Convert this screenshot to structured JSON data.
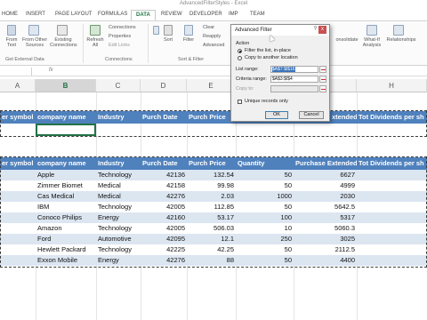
{
  "window": {
    "title": "AdvancedFilterStyles - Excel"
  },
  "tabs": [
    {
      "label": "HOME"
    },
    {
      "label": "INSERT"
    },
    {
      "label": "PAGE LAYOUT"
    },
    {
      "label": "FORMULAS"
    },
    {
      "label": "DATA"
    },
    {
      "label": "REVIEW"
    },
    {
      "label": "DEVELOPER"
    },
    {
      "label": "IMP"
    },
    {
      "label": "TEAM"
    }
  ],
  "ribbon": {
    "from_text": "From Text",
    "from_other_sources": "From Other Sources",
    "existing_connections": "Existing Connections",
    "refresh_all": "Refresh All",
    "connections": "Connections",
    "properties": "Properties",
    "edit_links": "Edit Links",
    "sort": "Sort",
    "filter": "Filter",
    "clear": "Clear",
    "reapply": "Reapply",
    "advanced": "Advanced",
    "consolidate": "onsolidate",
    "what_if": "What-If Analysis",
    "relationships": "Relationships",
    "group_get_external": "Get External Data",
    "group_connections": "Connections",
    "group_sort_filter": "Sort & Filter"
  },
  "columns": [
    "A",
    "B",
    "C",
    "D",
    "E",
    "H"
  ],
  "criteria_header": [
    "er symbol",
    "company name",
    "Industry",
    "Purch Date",
    "Purch Price",
    "xtended",
    "Tot Dividends per sh"
  ],
  "list_header": [
    "er symbol",
    "company name",
    "Industry",
    "Purch Date",
    "Purch Price",
    "Quantity",
    "Purchase Extended",
    "Tot Dividends per sh"
  ],
  "rows": [
    {
      "company": "Apple",
      "industry": "Technology",
      "date": "42136",
      "price": "132.54",
      "qty": "50",
      "ext": "6627"
    },
    {
      "company": "Zimmer Biomet",
      "industry": "Medical",
      "date": "42158",
      "price": "99.98",
      "qty": "50",
      "ext": "4999"
    },
    {
      "company": "Cas Medical",
      "industry": "Medical",
      "date": "42276",
      "price": "2.03",
      "qty": "1000",
      "ext": "2030"
    },
    {
      "company": "IBM",
      "industry": "Technology",
      "date": "42005",
      "price": "112.85",
      "qty": "50",
      "ext": "5642.5"
    },
    {
      "company": "Conoco Philips",
      "industry": "Energy",
      "date": "42160",
      "price": "53.17",
      "qty": "100",
      "ext": "5317"
    },
    {
      "company": "Amazon",
      "industry": "Technology",
      "date": "42005",
      "price": "506.03",
      "qty": "10",
      "ext": "5060.3"
    },
    {
      "company": "Ford",
      "industry": "Automotive",
      "date": "42095",
      "price": "12.1",
      "qty": "250",
      "ext": "3025"
    },
    {
      "company": "Hewlett Packard",
      "industry": "Technology",
      "date": "42225",
      "price": "42.25",
      "qty": "50",
      "ext": "2112.5"
    },
    {
      "company": "Exxon Mobile",
      "industry": "Energy",
      "date": "42276",
      "price": "88",
      "qty": "50",
      "ext": "4400"
    }
  ],
  "row_markers": [
    "",
    "",
    "",
    "",
    "",
    "",
    "",
    "",
    ""
  ],
  "dialog": {
    "title": "Advanced Filter",
    "help": "?",
    "close": "x",
    "action_label": "Action",
    "option_in_place": "Filter the list, in-place",
    "option_copy": "Copy to another location",
    "list_range_label": "List range:",
    "list_range_value": "$A$7:$I$16",
    "criteria_range_label": "Criteria range:",
    "criteria_range_value": "$A$3:$I$4",
    "copy_to_label": "Copy to:",
    "unique_label": "Unique records only",
    "ok": "OK",
    "cancel": "Cancel"
  }
}
